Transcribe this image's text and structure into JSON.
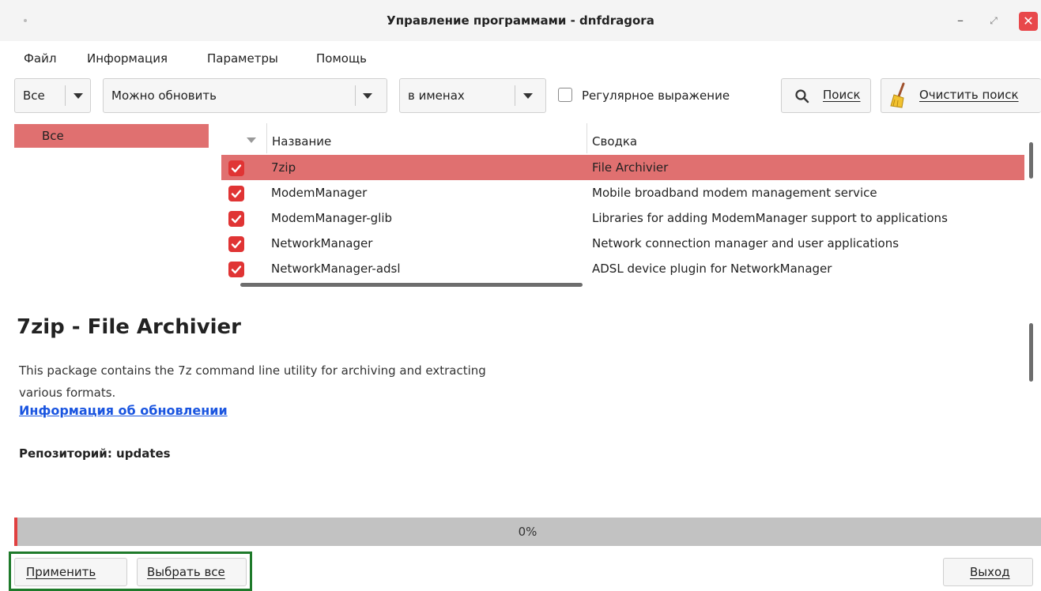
{
  "window": {
    "title": "Управление программами - dnfdragora",
    "minimize_glyph": "–",
    "maximize_glyph": "⤢",
    "close_glyph": "✕"
  },
  "menu": [
    "Файл",
    "Информация",
    "Параметры",
    "Помощь"
  ],
  "toolbar": {
    "scope": "Все",
    "filter": "Можно обновить",
    "search_field": "в именах",
    "regex_label": "Регулярное выражение",
    "regex_checked": false,
    "search_button": "Поиск",
    "clear_button": "Очистить поиск"
  },
  "groups": {
    "selected": "Все"
  },
  "table": {
    "columns": [
      "Название",
      "Сводка"
    ],
    "rows": [
      {
        "name": "7zip",
        "summary": "File Archivier",
        "checked": true,
        "selected": true
      },
      {
        "name": "ModemManager",
        "summary": "Mobile broadband modem management service",
        "checked": true,
        "selected": false
      },
      {
        "name": "ModemManager-glib",
        "summary": "Libraries for adding ModemManager support to applications",
        "checked": true,
        "selected": false
      },
      {
        "name": "NetworkManager",
        "summary": "Network connection manager and user applications",
        "checked": true,
        "selected": false
      },
      {
        "name": "NetworkManager-adsl",
        "summary": "ADSL device plugin for NetworkManager",
        "checked": true,
        "selected": false
      }
    ]
  },
  "details": {
    "title": "7zip - File Archivier",
    "description": "This package contains the 7z command line utility for archiving and extracting various formats.",
    "update_link": "Информация об обновлении",
    "repo": "Репозиторий: updates"
  },
  "progress": {
    "value": 0,
    "label": "0%"
  },
  "buttons": {
    "apply": "Применить",
    "select_all": "Выбрать все",
    "quit": "Выход"
  },
  "colors": {
    "selection": "#e07070",
    "checkbox": "#e03434",
    "close": "#e8484b",
    "link": "#1a55e0",
    "highlight_box": "#1e7a2a"
  },
  "icons": [
    "search-icon",
    "broom-icon",
    "check-icon",
    "close-icon"
  ]
}
